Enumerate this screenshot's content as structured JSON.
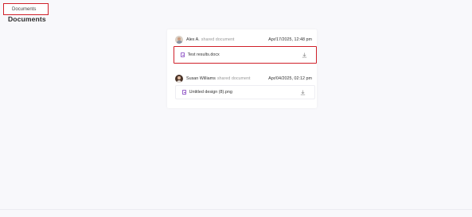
{
  "breadcrumb": {
    "label": "Documents"
  },
  "page": {
    "title": "Documents"
  },
  "shares": [
    {
      "sharer": "Alex A.",
      "action": "shared document",
      "date": "Apr/17/2025, 12:48 pm",
      "avatar_icon": "user-avatar",
      "file": {
        "name": "Test results.docx",
        "icon": "file-icon",
        "action_icon": "download-icon"
      }
    },
    {
      "sharer": "Susan Williams",
      "action": "shared document",
      "date": "Apr/04/2025, 02:12 pm",
      "avatar_icon": "user-avatar",
      "file": {
        "name": "Untitled design (8).png",
        "icon": "file-icon",
        "action_icon": "download-icon"
      }
    }
  ],
  "colors": {
    "highlight": "#d0202a",
    "file_icon": "#9b66cc",
    "background": "#f8f8fb"
  }
}
